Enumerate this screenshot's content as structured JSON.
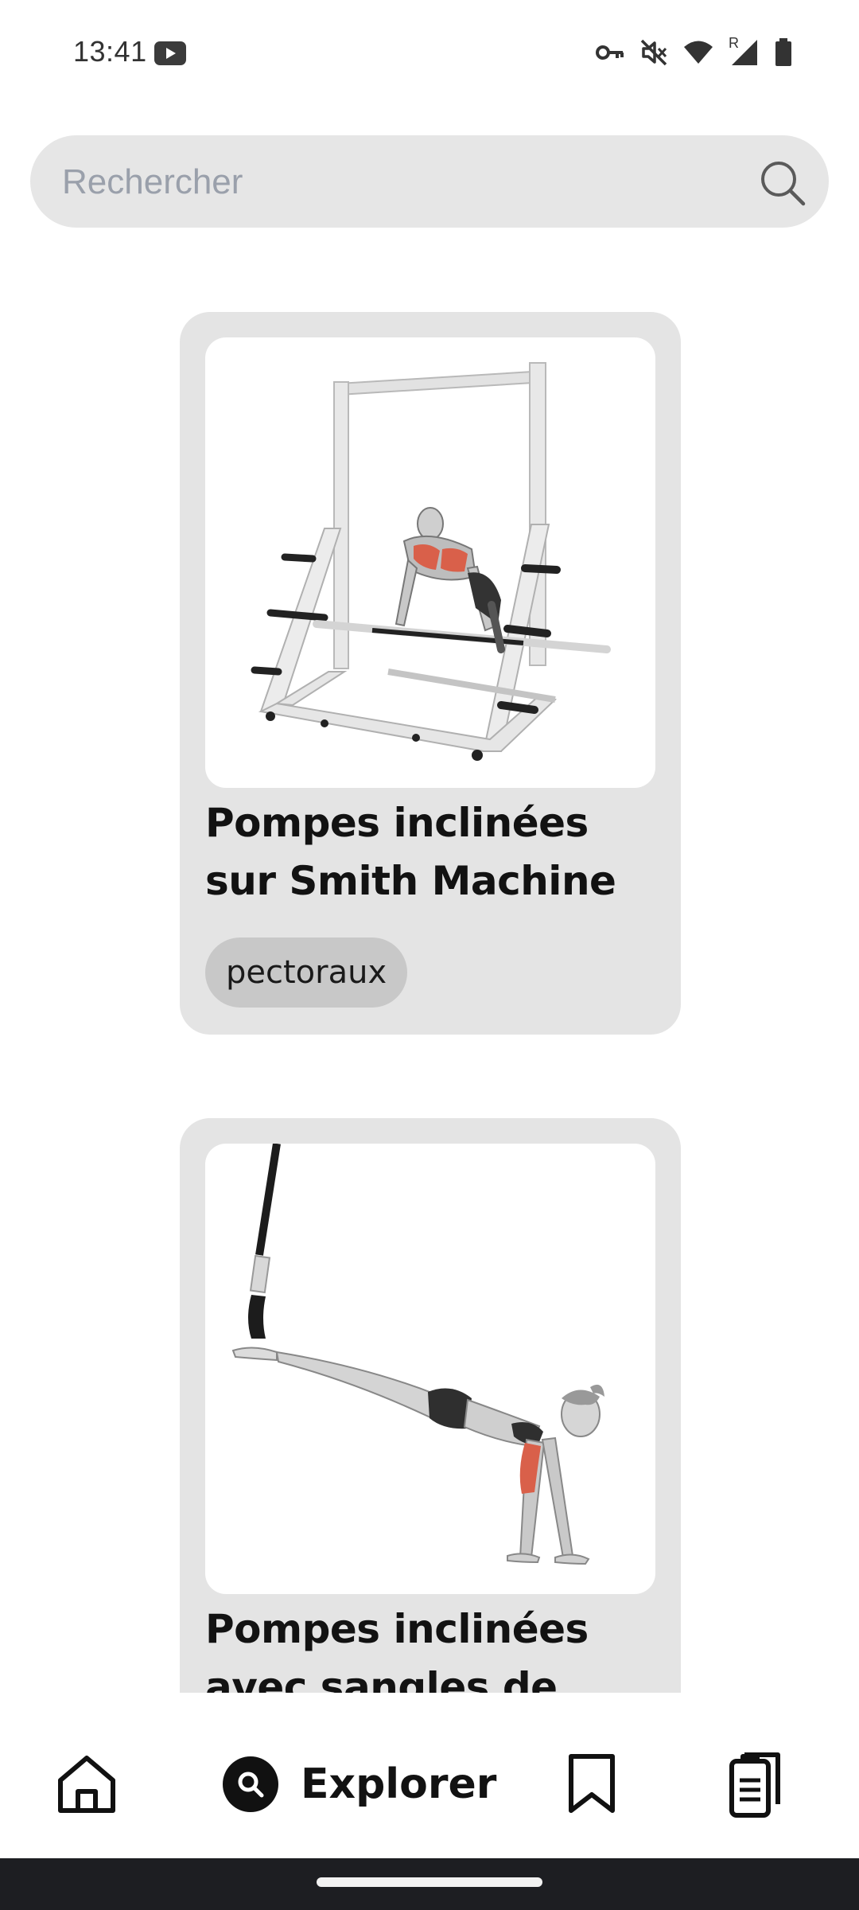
{
  "status_bar": {
    "time": "13:41",
    "icons": [
      "youtube-icon",
      "vpn-key-icon",
      "mute-icon",
      "wifi-icon",
      "signal-roaming-icon",
      "battery-icon"
    ],
    "roaming_label": "R"
  },
  "search": {
    "placeholder": "Rechercher",
    "value": "",
    "icon": "search-icon"
  },
  "exercises": [
    {
      "title": "Pompes inclinées sur Smith Machine",
      "tags": [
        "pectoraux"
      ],
      "image": "smith-machine-incline-pushup-illustration"
    },
    {
      "title": "Pompes inclinées avec sangles de",
      "tags": [],
      "image": "suspension-strap-pushup-illustration"
    }
  ],
  "bottom_nav": {
    "items": [
      {
        "id": "home",
        "icon": "home-icon",
        "label": "",
        "active": false
      },
      {
        "id": "explore",
        "icon": "search-icon",
        "label": "Explorer",
        "active": true
      },
      {
        "id": "saved",
        "icon": "bookmark-icon",
        "label": "",
        "active": false
      },
      {
        "id": "plans",
        "icon": "clipboard-icon",
        "label": "",
        "active": false
      }
    ]
  },
  "colors": {
    "background": "#ffffff",
    "card": "#e4e4e4",
    "search_bg": "#e6e6e6",
    "tag_bg": "#c8c8c8",
    "muscle_highlight": "#d9604a",
    "text": "#121212",
    "system_nav": "#1d1e22"
  }
}
